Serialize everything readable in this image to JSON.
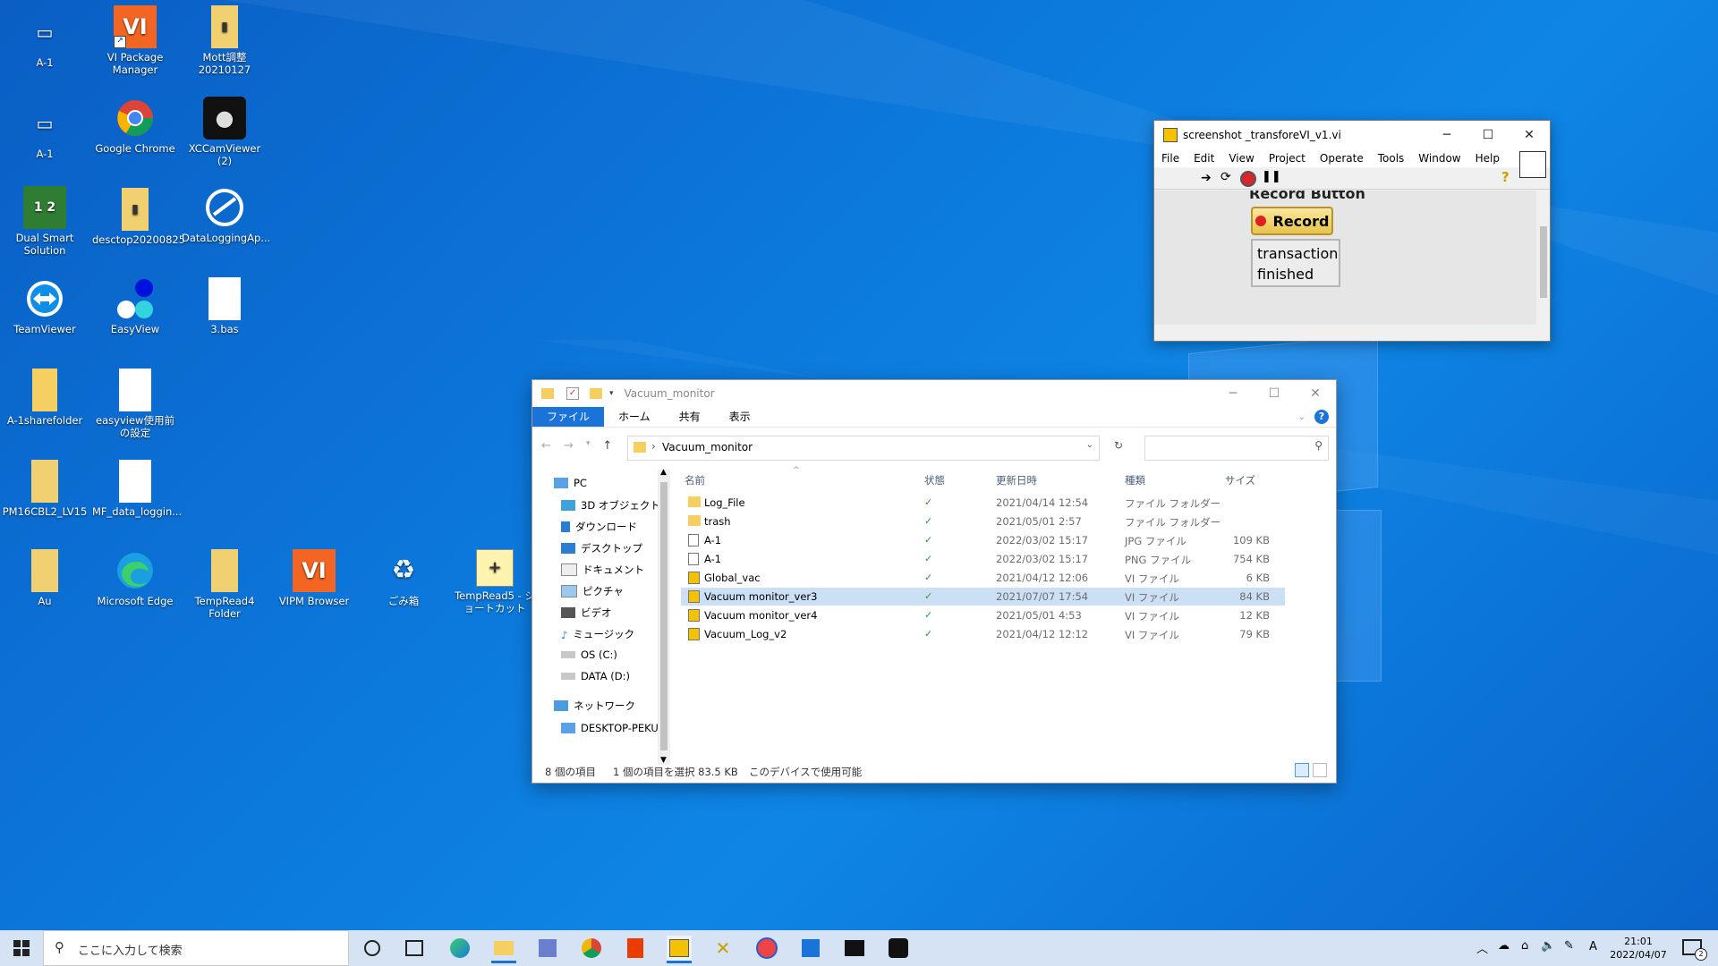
{
  "desktop": {
    "icons": [
      {
        "label": "A-1"
      },
      {
        "label": "VI Package Manager"
      },
      {
        "label": "Mott調整 20210127"
      },
      {
        "label": "A-1"
      },
      {
        "label": "Google Chrome"
      },
      {
        "label": "XCCamViewer (2)"
      },
      {
        "label": "Dual Smart Solution"
      },
      {
        "label": "desctop20200825"
      },
      {
        "label": "DataLoggingAp..."
      },
      {
        "label": "TeamViewer"
      },
      {
        "label": "EasyView"
      },
      {
        "label": "3.bas"
      },
      {
        "label": "A-1sharefolder"
      },
      {
        "label": "easyview使用前の設定"
      },
      {
        "label": "PM16CBL2_LV15"
      },
      {
        "label": "MF_data_loggin..."
      },
      {
        "label": "Au"
      },
      {
        "label": "Microsoft Edge"
      },
      {
        "label": "TempRead4 Folder"
      },
      {
        "label": "VIPM Browser"
      },
      {
        "label": "ごみ箱"
      },
      {
        "label": "TempRead5 - ショートカット"
      }
    ],
    "icon_glyphs": {
      "vi": "VI"
    }
  },
  "labview": {
    "title": "screenshot _transforeVI_v1.vi",
    "menu": [
      "File",
      "Edit",
      "View",
      "Project",
      "Operate",
      "Tools",
      "Window",
      "Help"
    ],
    "record_label": "Record Button",
    "record_button": "Record",
    "status_text_line1": "transaction",
    "status_text_line2": "finished",
    "help_glyph": "?"
  },
  "explorer": {
    "title": "Vacuum_monitor",
    "ribbon_tabs": [
      "ファイル",
      "ホーム",
      "共有",
      "表示"
    ],
    "breadcrumb": "Vacuum_monitor",
    "search_placeholder": "",
    "nav": [
      {
        "label": "PC"
      },
      {
        "label": "3D オブジェクト"
      },
      {
        "label": "ダウンロード"
      },
      {
        "label": "デスクトップ"
      },
      {
        "label": "ドキュメント"
      },
      {
        "label": "ピクチャ"
      },
      {
        "label": "ビデオ"
      },
      {
        "label": "ミュージック"
      },
      {
        "label": "OS (C:)"
      },
      {
        "label": "DATA (D:)"
      },
      {
        "label": "ネットワーク"
      },
      {
        "label": "DESKTOP-PEKUE"
      }
    ],
    "columns": {
      "name": "名前",
      "status": "状態",
      "date": "更新日時",
      "type": "種類",
      "size": "サイズ"
    },
    "files": [
      {
        "name": "Log_File",
        "status": "✓",
        "date": "2021/04/14 12:54",
        "type": "ファイル フォルダー",
        "size": ""
      },
      {
        "name": "trash",
        "status": "✓",
        "date": "2021/05/01 2:57",
        "type": "ファイル フォルダー",
        "size": ""
      },
      {
        "name": "A-1",
        "status": "✓",
        "date": "2022/03/02 15:17",
        "type": "JPG ファイル",
        "size": "109 KB"
      },
      {
        "name": "A-1",
        "status": "✓",
        "date": "2022/03/02 15:17",
        "type": "PNG ファイル",
        "size": "754 KB"
      },
      {
        "name": "Global_vac",
        "status": "✓",
        "date": "2021/04/12 12:06",
        "type": "VI ファイル",
        "size": "6 KB"
      },
      {
        "name": "Vacuum monitor_ver3",
        "status": "✓",
        "date": "2021/07/07 17:54",
        "type": "VI ファイル",
        "size": "84 KB"
      },
      {
        "name": "Vacuum monitor_ver4",
        "status": "✓",
        "date": "2021/05/01 4:53",
        "type": "VI ファイル",
        "size": "12 KB"
      },
      {
        "name": "Vacuum_Log_v2",
        "status": "✓",
        "date": "2021/04/12 12:12",
        "type": "VI ファイル",
        "size": "79 KB"
      }
    ],
    "status_items": "8 個の項目",
    "status_selected": "1 個の項目を選択 83.5 KB",
    "status_availability": "このデバイスで使用可能"
  },
  "taskbar": {
    "search_placeholder": "ここに入力して検索",
    "ime": "A",
    "time": "21:01",
    "date": "2022/04/07",
    "notifications": "2"
  }
}
